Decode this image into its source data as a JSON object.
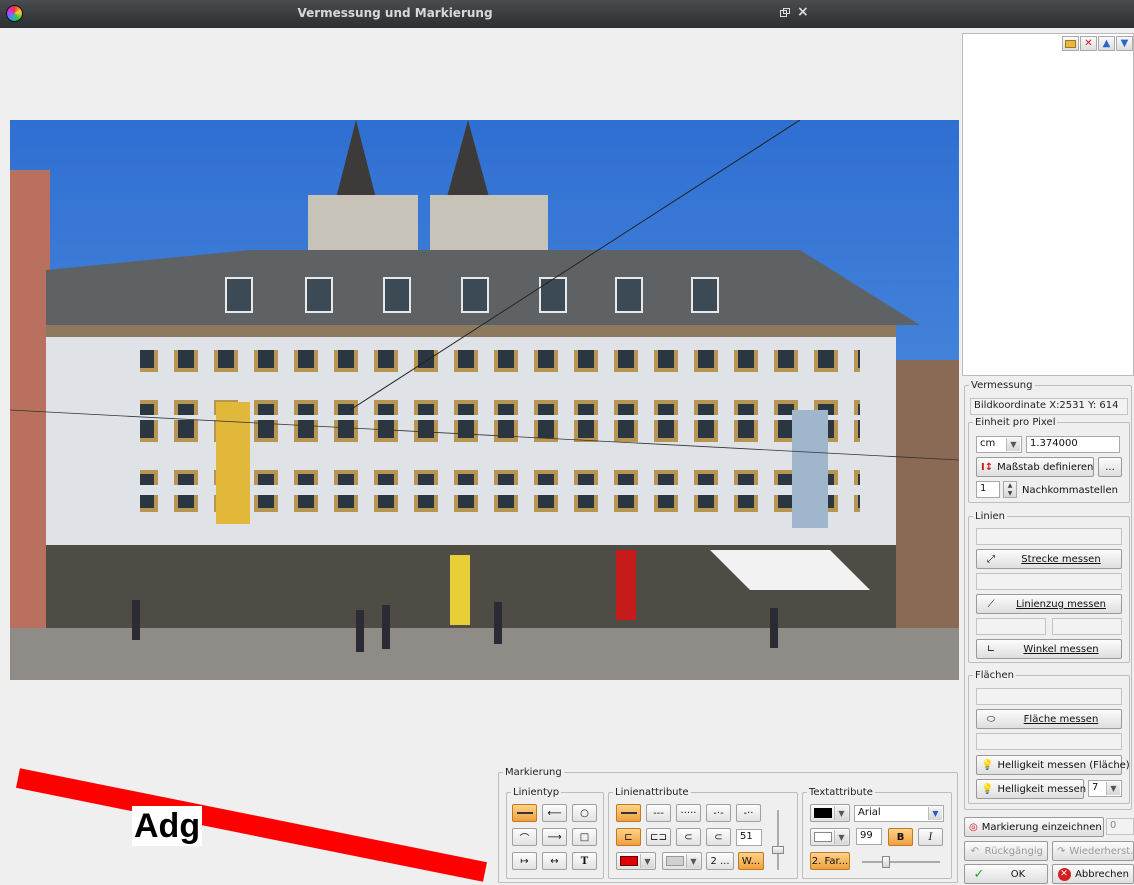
{
  "window": {
    "title": "Vermessung und Markierung"
  },
  "annotation": {
    "text": "Adg",
    "color": "#ff0000"
  },
  "vermessung": {
    "legend": "Vermessung",
    "coord": "Bildkoordinate X:2531 Y: 614",
    "einheit": {
      "legend": "Einheit pro Pixel",
      "unit": "cm",
      "value": "1.374000",
      "massstab_label": "Maßstab definieren",
      "extra_label": "...",
      "decimals": "1",
      "decimals_label": "Nachkommastellen"
    },
    "linien": {
      "legend": "Linien",
      "strecke": "Strecke messen",
      "linienzug": "Linienzug messen",
      "winkel": "Winkel messen"
    },
    "flaechen": {
      "legend": "Flächen",
      "flaeche": "Fläche messen",
      "helligkeit_flaeche": "Helligkeit messen (Fläche)",
      "helligkeit": "Helligkeit messen",
      "helligkeit_value": "7"
    }
  },
  "actions": {
    "markierung_einzeichnen": "Markierung einzeichnen",
    "markierung_count": "0",
    "rueckgaengig": "Rückgängig",
    "wiederherst": "Wiederherst.",
    "ok": "OK",
    "abbrechen": "Abbrechen"
  },
  "markierung": {
    "legend": "Markierung",
    "linientyp": {
      "legend": "Linientyp",
      "text_glyph": "T"
    },
    "linienattribute": {
      "legend": "Linienattribute",
      "width": "51",
      "btn_2": "2 ...",
      "btn_w": "W...",
      "line_color": "#e00000"
    },
    "textattribute": {
      "legend": "Textattribute",
      "font": "Arial",
      "size": "99",
      "bold": "B",
      "italic": "I",
      "two_colors": "2. Far..."
    }
  }
}
